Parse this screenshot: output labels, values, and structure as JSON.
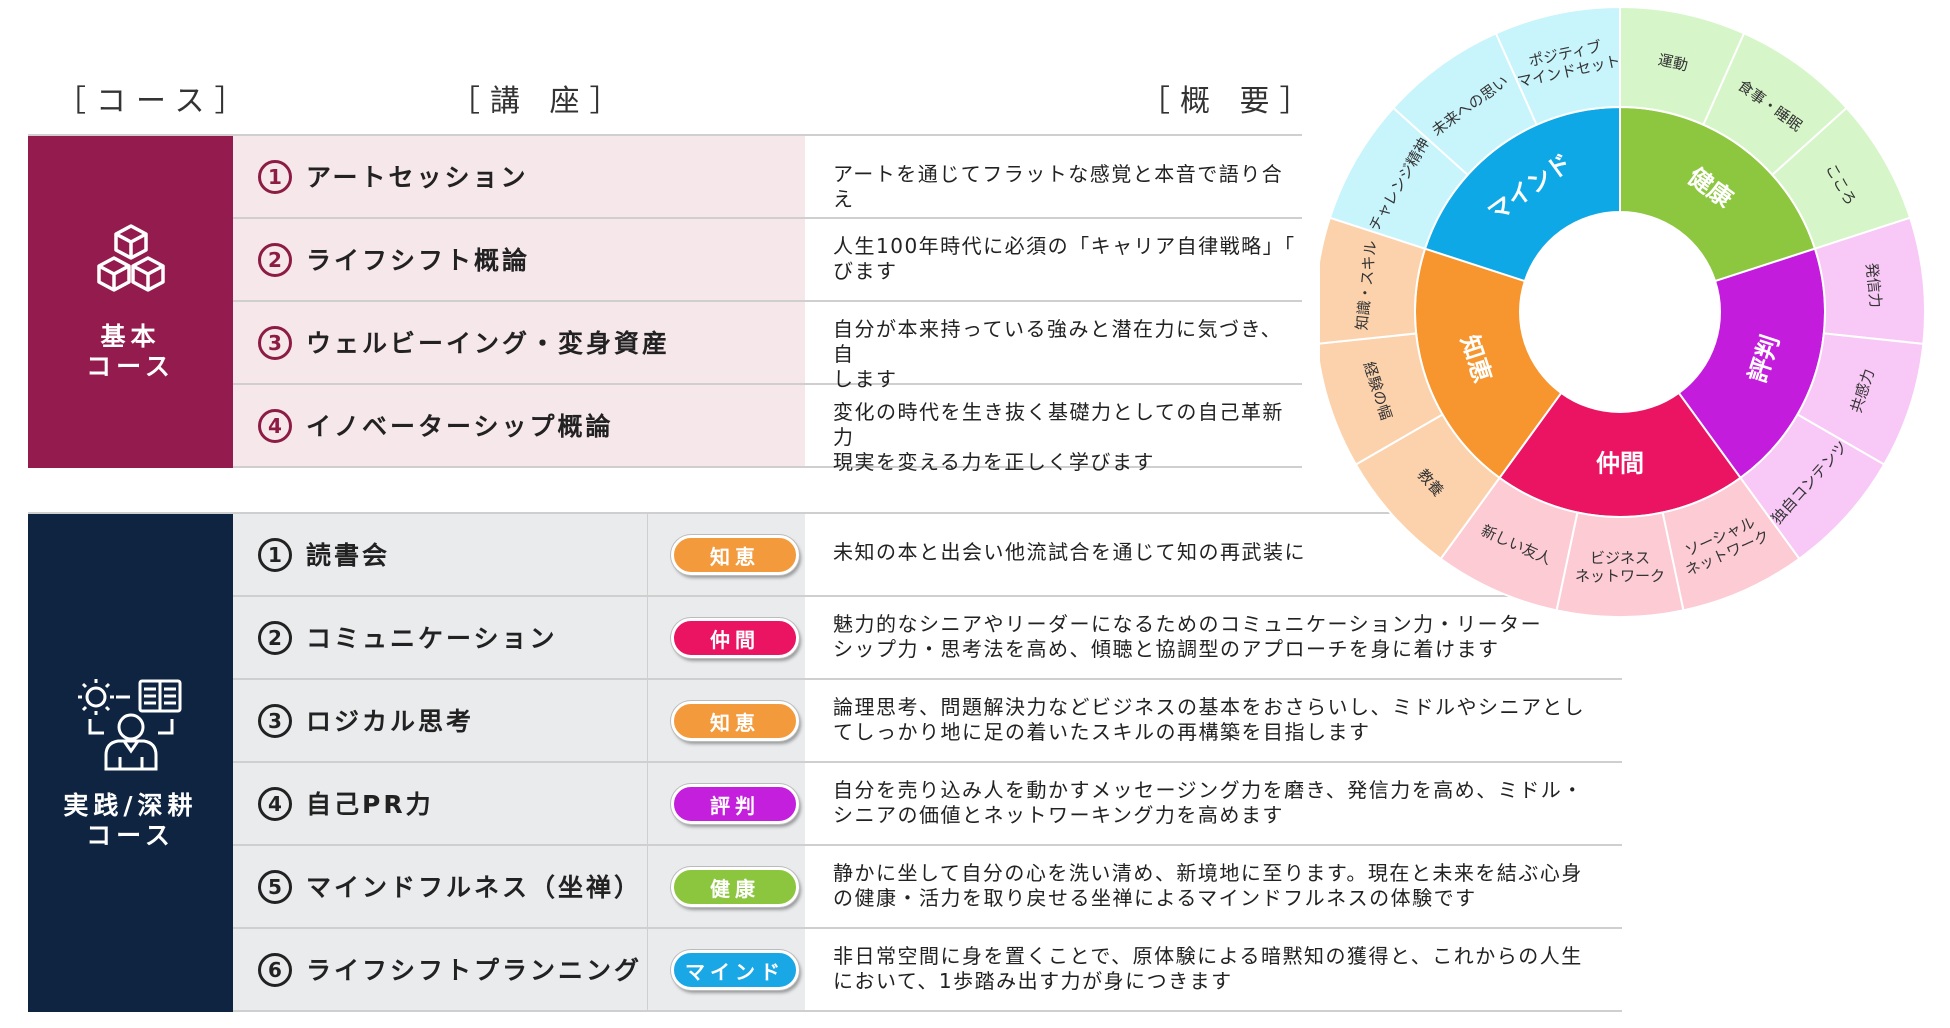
{
  "headers": {
    "course": "［コース］",
    "lecture": "［講 座］",
    "summary": "［概 要］"
  },
  "basic": {
    "label": "基本\nコース",
    "color": "#941b4e",
    "rows": [
      {
        "num": "1",
        "name": "アートセッション",
        "desc": "アートを通じてフラットな感覚と本音で語り合え"
      },
      {
        "num": "2",
        "name": "ライフシフト概論",
        "desc": "人生100年時代に必須の「キャリア自律戦略」「\nびます"
      },
      {
        "num": "3",
        "name": "ウェルビーイング・変身資産",
        "desc": "自分が本来持っている強みと潜在力に気づき、自\nします"
      },
      {
        "num": "4",
        "name": "イノベーターシップ概論",
        "desc": "変化の時代を生き抜く基礎力としての自己革新力\n現実を変える力を正しく学びます"
      }
    ]
  },
  "practice": {
    "label": "実践/深耕\nコース",
    "color": "#0e2440",
    "rows": [
      {
        "num": "1",
        "name": "読書会",
        "tag": "知恵",
        "tag_color": "#f39a3c",
        "desc": "未知の本と出会い他流試合を通じて知の再武装に"
      },
      {
        "num": "2",
        "name": "コミュニケーション",
        "tag": "仲間",
        "tag_color": "#ea1463",
        "desc": "魅力的なシニアやリーダーになるためのコミュニケーション力・リーター\nシップ力・思考法を高め、傾聴と協調型のアプローチを身に着けます"
      },
      {
        "num": "3",
        "name": "ロジカル思考",
        "tag": "知恵",
        "tag_color": "#f39a3c",
        "desc": "論理思考、問題解決力などビジネスの基本をおさらいし、ミドルやシニアとし\nてしっかり地に足の着いたスキルの再構築を目指します"
      },
      {
        "num": "4",
        "name": "自己PR力",
        "tag": "評判",
        "tag_color": "#c31fdc",
        "desc": "自分を売り込み人を動かすメッセージング力を磨き、発信力を高め、ミドル・\nシニアの価値とネットワーキング力を高めます"
      },
      {
        "num": "5",
        "name": "マインドフルネス（坐禅）",
        "tag": "健康",
        "tag_color": "#8cc63f",
        "desc": "静かに坐して自分の心を洗い清め、新境地に至ります。現在と未来を結ぶ心身\nの健康・活力を取り戻せる坐禅によるマインドフルネスの体験です"
      },
      {
        "num": "6",
        "name": "ライフシフトプランニング",
        "tag": "マインド",
        "tag_color": "#1aa7e6",
        "desc": "非日常空間に身を置くことで、原体験による暗黙知の獲得と、これからの人生\nにおいて、1歩踏み出す力が身につきます"
      }
    ]
  },
  "wheel": {
    "segments": [
      {
        "name": "健康",
        "color": "#8dc63f",
        "light": "#d6f5c8",
        "subs": [
          "運動",
          "食事・睡眠",
          "こころ"
        ]
      },
      {
        "name": "評判",
        "color": "#c41cdc",
        "light": "#f8c8f6",
        "subs": [
          "発信力",
          "共感力",
          "独自コンテンツ"
        ]
      },
      {
        "name": "仲間",
        "color": "#ea1463",
        "light": "#fccbd4",
        "subs": [
          "ソーシャル\nネットワーク",
          "ビジネス\nネットワーク",
          "新しい友人"
        ]
      },
      {
        "name": "知恵",
        "color": "#f7962e",
        "light": "#fcd2ad",
        "subs": [
          "教養",
          "経験の幅",
          "知識・スキル"
        ]
      },
      {
        "name": "マインド",
        "color": "#0fa8e6",
        "light": "#c8f4fb",
        "subs": [
          "チャレンジ精神",
          "未来への思い",
          "ポジティブ\nマインドセット"
        ]
      }
    ]
  }
}
